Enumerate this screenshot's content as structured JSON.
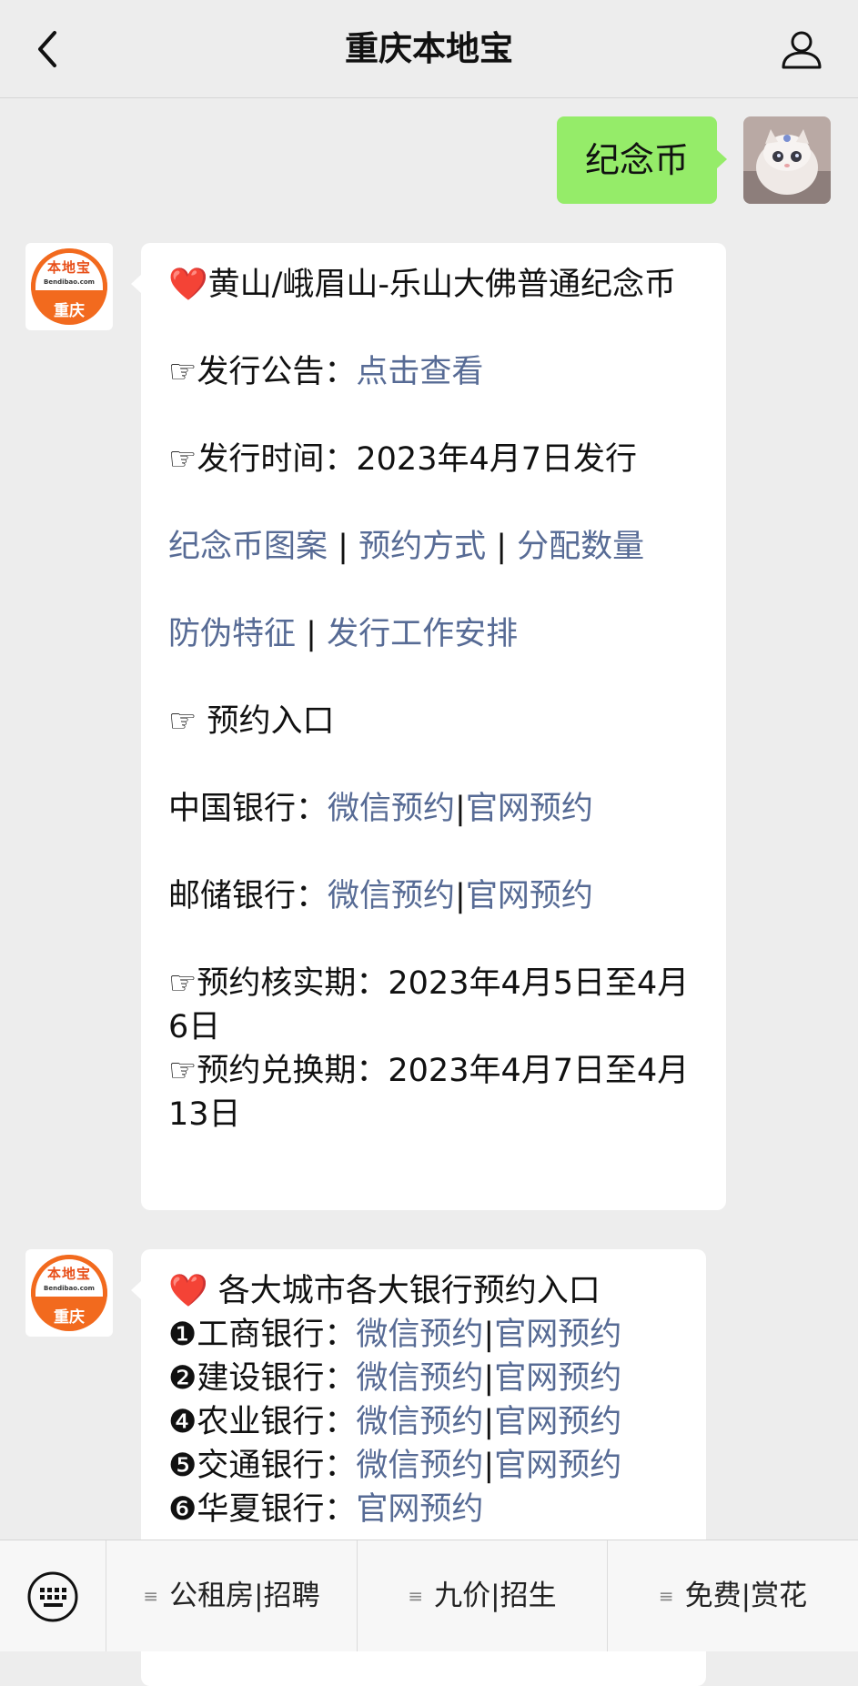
{
  "header": {
    "title": "重庆本地宝",
    "back_icon": "chevron-left-icon",
    "user_icon": "user-icon"
  },
  "user_message": {
    "text": "纪念币",
    "bubble_color": "#95ec69"
  },
  "bot": {
    "avatar_logo": "本地宝",
    "avatar_domain": "Bendibao.com",
    "avatar_city": "重庆",
    "brand_color": "#f26a1e"
  },
  "message1": {
    "heart": "❤️",
    "title": "黄山/峨眉山-乐山大佛普通纪念币",
    "notice_label": "☞发行公告：",
    "notice_link": "点击查看",
    "issue_label": "☞发行时间：",
    "issue_value": "2023年4月7日发行",
    "links_row1": [
      "纪念币图案",
      "预约方式",
      "分配数量"
    ],
    "links_row2": [
      "防伪特征",
      "发行工作安排"
    ],
    "separator": " | ",
    "entry_label": "☞ 预约入口",
    "banks": [
      {
        "name": "中国银行：",
        "wechat": "微信预约",
        "sep": "|",
        "web": "官网预约"
      },
      {
        "name": "邮储银行：",
        "wechat": "微信预约",
        "sep": "|",
        "web": "官网预约"
      }
    ],
    "verify_label": "☞预约核实期：",
    "verify_value": "2023年4月5日至4月6日",
    "exchange_label": "☞预约兑换期：",
    "exchange_value": "2023年4月7日至4月13日",
    "link_color": "#576b95"
  },
  "message2": {
    "heart": "❤️",
    "title": " 各大城市各大银行预约入口",
    "banks": [
      {
        "num": "❶",
        "name": "工商银行：",
        "wechat": "微信预约",
        "sep": "|",
        "web": "官网预约"
      },
      {
        "num": "❷",
        "name": "建设银行：",
        "wechat": "微信预约",
        "sep": "|",
        "web": "官网预约"
      },
      {
        "num": "❹",
        "name": "农业银行：",
        "wechat": "微信预约",
        "sep": "|",
        "web": "官网预约"
      },
      {
        "num": "❺",
        "name": "交通银行：",
        "wechat": "微信预约",
        "sep": "|",
        "web": "官网预约"
      },
      {
        "num": "❻",
        "name": "华夏银行：",
        "web": "官网预约"
      }
    ]
  },
  "menu": {
    "keyboard_icon": "keyboard-icon",
    "items": [
      {
        "icon": "≡",
        "label": "公租房|招聘"
      },
      {
        "icon": "≡",
        "label": "九价|招生"
      },
      {
        "icon": "≡",
        "label": "免费|赏花"
      }
    ]
  }
}
